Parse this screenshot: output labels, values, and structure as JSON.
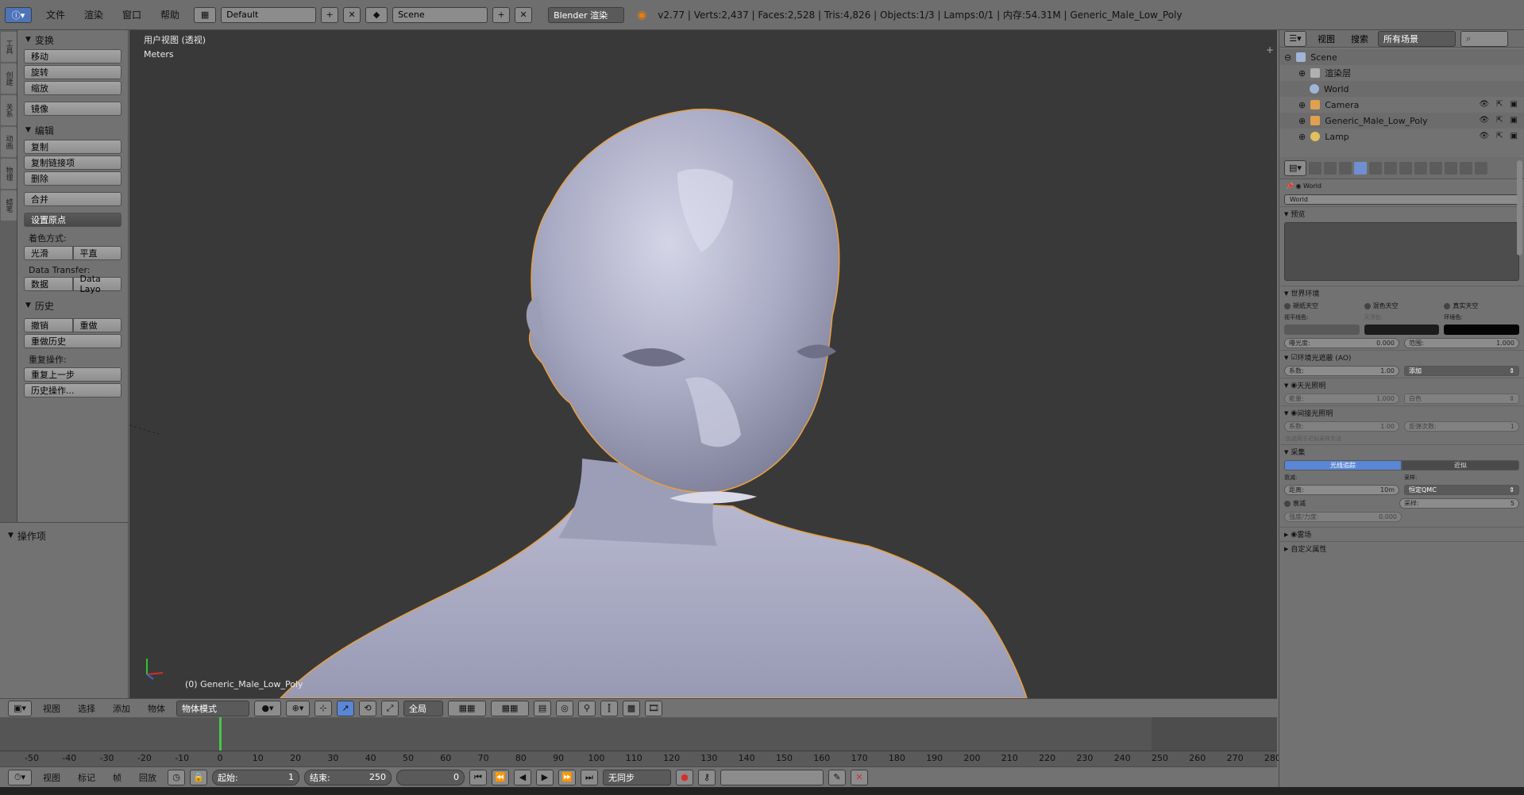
{
  "topbar": {
    "menus": [
      "文件",
      "渲染",
      "窗口",
      "帮助"
    ],
    "screen_layout": "Default",
    "scene": "Scene",
    "engine": "Blender 渲染",
    "stats": "v2.77 | Verts:2,437 | Faces:2,528 | Tris:4,826 | Objects:1/3 | Lamps:0/1 | 内存:54.31M | Generic_Male_Low_Poly"
  },
  "tool_tabs": [
    "工具",
    "创建",
    "关系",
    "动画",
    "物理",
    "蜡笔"
  ],
  "toolshelf": {
    "transform": {
      "title": "变换",
      "move": "移动",
      "rotate": "旋转",
      "scale": "缩放",
      "mirror": "镜像"
    },
    "edit": {
      "title": "编辑",
      "duplicate": "复制",
      "duplicate_linked": "复制链接项",
      "delete": "删除",
      "join": "合并",
      "set_origin": "设置原点",
      "shading_label": "着色方式:",
      "smooth": "光滑",
      "flat": "平直",
      "data_transfer_label": "Data Transfer:",
      "data": "数据",
      "data_layout": "Data Layo"
    },
    "history": {
      "title": "历史",
      "undo": "撤销",
      "redo": "重做",
      "undo_history": "重做历史",
      "repeat_label": "重复操作:",
      "repeat_last": "重复上一步",
      "history_ops": "历史操作..."
    },
    "operator": {
      "title": "操作项"
    }
  },
  "viewport": {
    "view_name": "用户视图 (透视)",
    "units": "Meters",
    "object_label": "(0) Generic_Male_Low_Poly"
  },
  "viewport_header": {
    "menus": [
      "视图",
      "选择",
      "添加",
      "物体"
    ],
    "mode": "物体模式",
    "pivot": "全局"
  },
  "timeline": {
    "ticks": [
      "-50",
      "-40",
      "-30",
      "-20",
      "-10",
      "0",
      "10",
      "20",
      "30",
      "40",
      "50",
      "60",
      "70",
      "80",
      "90",
      "100",
      "110",
      "120",
      "130",
      "140",
      "150",
      "160",
      "170",
      "180",
      "190",
      "200",
      "210",
      "220",
      "230",
      "240",
      "250",
      "260",
      "270",
      "280"
    ],
    "current_frame": 0,
    "menus": [
      "视图",
      "标记",
      "帧",
      "回放"
    ],
    "start_label": "起始:",
    "start": "1",
    "end_label": "结束:",
    "end": "250",
    "frame": "0",
    "sync": "无同步"
  },
  "outliner": {
    "menus": [
      "视图",
      "搜索"
    ],
    "filter": "所有场景",
    "items": [
      {
        "name": "Scene",
        "color": "#9fb4d6"
      },
      {
        "name": "渲染层",
        "color": "#b0b0b0"
      },
      {
        "name": "World",
        "color": "#9fb4d6"
      },
      {
        "name": "Camera",
        "color": "#e0a050"
      },
      {
        "name": "Generic_Male_Low_Poly",
        "color": "#e0a050"
      },
      {
        "name": "Lamp",
        "color": "#e0c060"
      }
    ]
  },
  "properties": {
    "context": "World",
    "world_name": "World",
    "preview": "预览",
    "world_env": "世界环境",
    "sky_options": [
      "褪纸天空",
      "混色天空",
      "真实天空"
    ],
    "color_labels": [
      "视平线色:",
      "天顶色:",
      "环境色:"
    ],
    "exposure_label": "曝光度:",
    "exposure": "0.000",
    "range_label": "范围:",
    "range": "1.000",
    "ao": "环境光遮蔽 (AO)",
    "ao_factor_label": "系数:",
    "ao_factor": "1.00",
    "ao_blend": "添加",
    "env_light": "天光照明",
    "env_energy_label": "能量:",
    "env_energy": "1.000",
    "env_color": "白色",
    "indirect": "间接光照明",
    "ind_factor_label": "系数:",
    "ind_factor": "1.00",
    "ind_bounces_label": "反弹次数:",
    "ind_bounces": "1",
    "indirect_note": "仅适用于近似采样方法",
    "gather": "采集",
    "gather_modes": [
      "光线追踪",
      "近似"
    ],
    "atten_label": "衰减:",
    "sampling_label": "采样:",
    "distance_label": "距离:",
    "distance": "10m",
    "sampling_method": "恒定QMC",
    "falloff_label": "衰减",
    "samples_label": "采样:",
    "samples": "5",
    "strength_label": "强度/力度:",
    "strength": "0.000",
    "mist": "雾场",
    "custom_props": "自定义属性"
  },
  "colors": {
    "selection_outline": "#e8a040",
    "mesh": "#a9aac4",
    "viewport_bg": "#393939",
    "active_blue": "#5a86d6"
  }
}
